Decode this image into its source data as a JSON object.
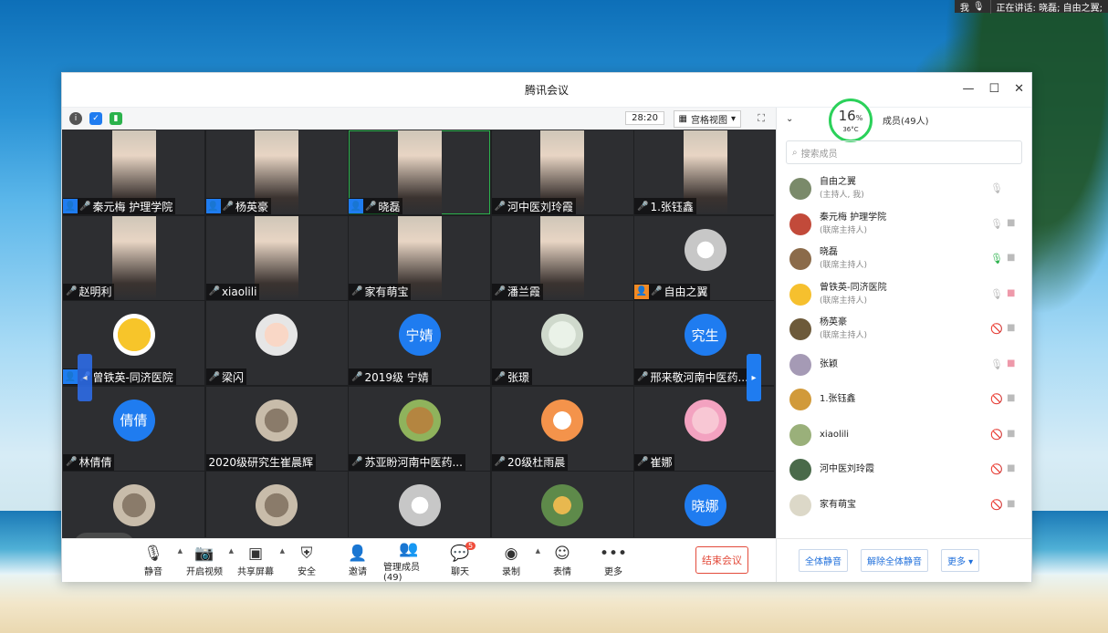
{
  "topbar": {
    "me": "我",
    "speaking": "正在讲话: 晓磊; 自由之翼;"
  },
  "window": {
    "title": "腾讯会议",
    "controls": [
      "—",
      "☐",
      "✕"
    ]
  },
  "infobar": {
    "timer": "28:20",
    "view": "宫格视图"
  },
  "tiles": [
    {
      "name": "秦元梅  护理学院",
      "type": "video",
      "host": "blue",
      "mic": "🎤"
    },
    {
      "name": "杨英豪",
      "type": "video",
      "host": "blue",
      "mic": "🎤"
    },
    {
      "name": "晓磊",
      "type": "video",
      "host": "blue",
      "mic": "🎤",
      "speaking": true
    },
    {
      "name": "河中医刘玲霞",
      "type": "video",
      "mic": "🎤"
    },
    {
      "name": "1.张钰鑫",
      "type": "video",
      "mic": "🎤"
    },
    {
      "name": "赵明利",
      "type": "video",
      "mic": "🎤"
    },
    {
      "name": "xiaolili",
      "type": "video",
      "mic": "🎤"
    },
    {
      "name": "家有萌宝",
      "type": "video",
      "mic": "🎤"
    },
    {
      "name": "潘兰霞",
      "type": "video",
      "mic": "🎤"
    },
    {
      "name": "自由之翼",
      "type": "avatar",
      "av": "grey",
      "host": "org",
      "mic": "🎤"
    },
    {
      "name": "曾铁英-同济医院",
      "type": "avatar",
      "av": "sun",
      "host": "blue",
      "mic": "🎤"
    },
    {
      "name": "梁闪",
      "type": "avatar",
      "av": "baby",
      "mic": "🎤"
    },
    {
      "name": "2019级 宁婧",
      "type": "avatar",
      "av": "blue",
      "label": "宁婧",
      "mic": "🎤"
    },
    {
      "name": "张璟",
      "type": "avatar",
      "av": "plant",
      "mic": "🎤"
    },
    {
      "name": "邢来敬河南中医药...",
      "type": "avatar",
      "av": "blue",
      "label": "究生",
      "mic": "🎤"
    },
    {
      "name": "林倩倩",
      "type": "avatar",
      "av": "blue",
      "label": "倩倩",
      "mic": "🎤"
    },
    {
      "name": "2020级研究生崔晨辉",
      "type": "avatar",
      "av": "dark"
    },
    {
      "name": "苏亚盼河南中医药...",
      "type": "avatar",
      "av": "dog",
      "mic": "🎤"
    },
    {
      "name": "20级杜雨晨",
      "type": "avatar",
      "av": "rabbit",
      "mic": "🎤"
    },
    {
      "name": "崔娜",
      "type": "avatar",
      "av": "anime",
      "mic": "🎤"
    },
    {
      "name": "",
      "type": "avatar",
      "av": "dark"
    },
    {
      "name": "",
      "type": "avatar",
      "av": "dark"
    },
    {
      "name": "",
      "type": "avatar",
      "av": "grey"
    },
    {
      "name": "",
      "type": "avatar",
      "av": "flower"
    },
    {
      "name": "",
      "type": "avatar",
      "av": "blue",
      "label": "晓娜"
    }
  ],
  "toolbar": {
    "items": [
      {
        "label": "静音",
        "icon": "mic-icon",
        "caret": true
      },
      {
        "label": "开启视频",
        "icon": "camera-off-icon",
        "caret": true
      },
      {
        "label": "共享屏幕",
        "icon": "share-screen-icon",
        "caret": true
      },
      {
        "label": "安全",
        "icon": "shield-icon"
      },
      {
        "label": "邀请",
        "icon": "add-user-icon"
      },
      {
        "label": "管理成员(49)",
        "icon": "members-icon"
      },
      {
        "label": "聊天",
        "icon": "chat-icon",
        "badge": "5"
      },
      {
        "label": "录制",
        "icon": "record-icon",
        "caret": true
      },
      {
        "label": "表情",
        "icon": "emoji-icon"
      },
      {
        "label": "更多",
        "icon": "more-icon"
      }
    ],
    "end": "结束会议"
  },
  "panel": {
    "members_title": "成员(49人)",
    "gauge_pct": "16",
    "gauge_unit": "%",
    "gauge_temp": "36°C",
    "search_placeholder": "搜索成员",
    "members": [
      {
        "name": "自由之翼",
        "role": "(主持人, 我)",
        "mic": "idle",
        "cam": "none"
      },
      {
        "name": "秦元梅  护理学院",
        "role": "(联席主持人)",
        "mic": "idle",
        "cam": "idle"
      },
      {
        "name": "晓磊",
        "role": "(联席主持人)",
        "mic": "on",
        "cam": "idle"
      },
      {
        "name": "曾铁英-同济医院",
        "role": "(联席主持人)",
        "mic": "idle",
        "cam": "off"
      },
      {
        "name": "杨英豪",
        "role": "(联席主持人)",
        "mic": "off",
        "cam": "idle"
      },
      {
        "name": "张颖",
        "role": "",
        "mic": "idle",
        "cam": "off"
      },
      {
        "name": "1.张钰鑫",
        "role": "",
        "mic": "off",
        "cam": "idle"
      },
      {
        "name": "xiaolili",
        "role": "",
        "mic": "off",
        "cam": "idle"
      },
      {
        "name": "河中医刘玲霞",
        "role": "",
        "mic": "off",
        "cam": "idle"
      },
      {
        "name": "家有萌宝",
        "role": "",
        "mic": "off",
        "cam": "idle"
      }
    ],
    "buttons": {
      "mute_all": "全体静音",
      "unmute_all": "解除全体静音",
      "more": "更多 ▾"
    }
  }
}
